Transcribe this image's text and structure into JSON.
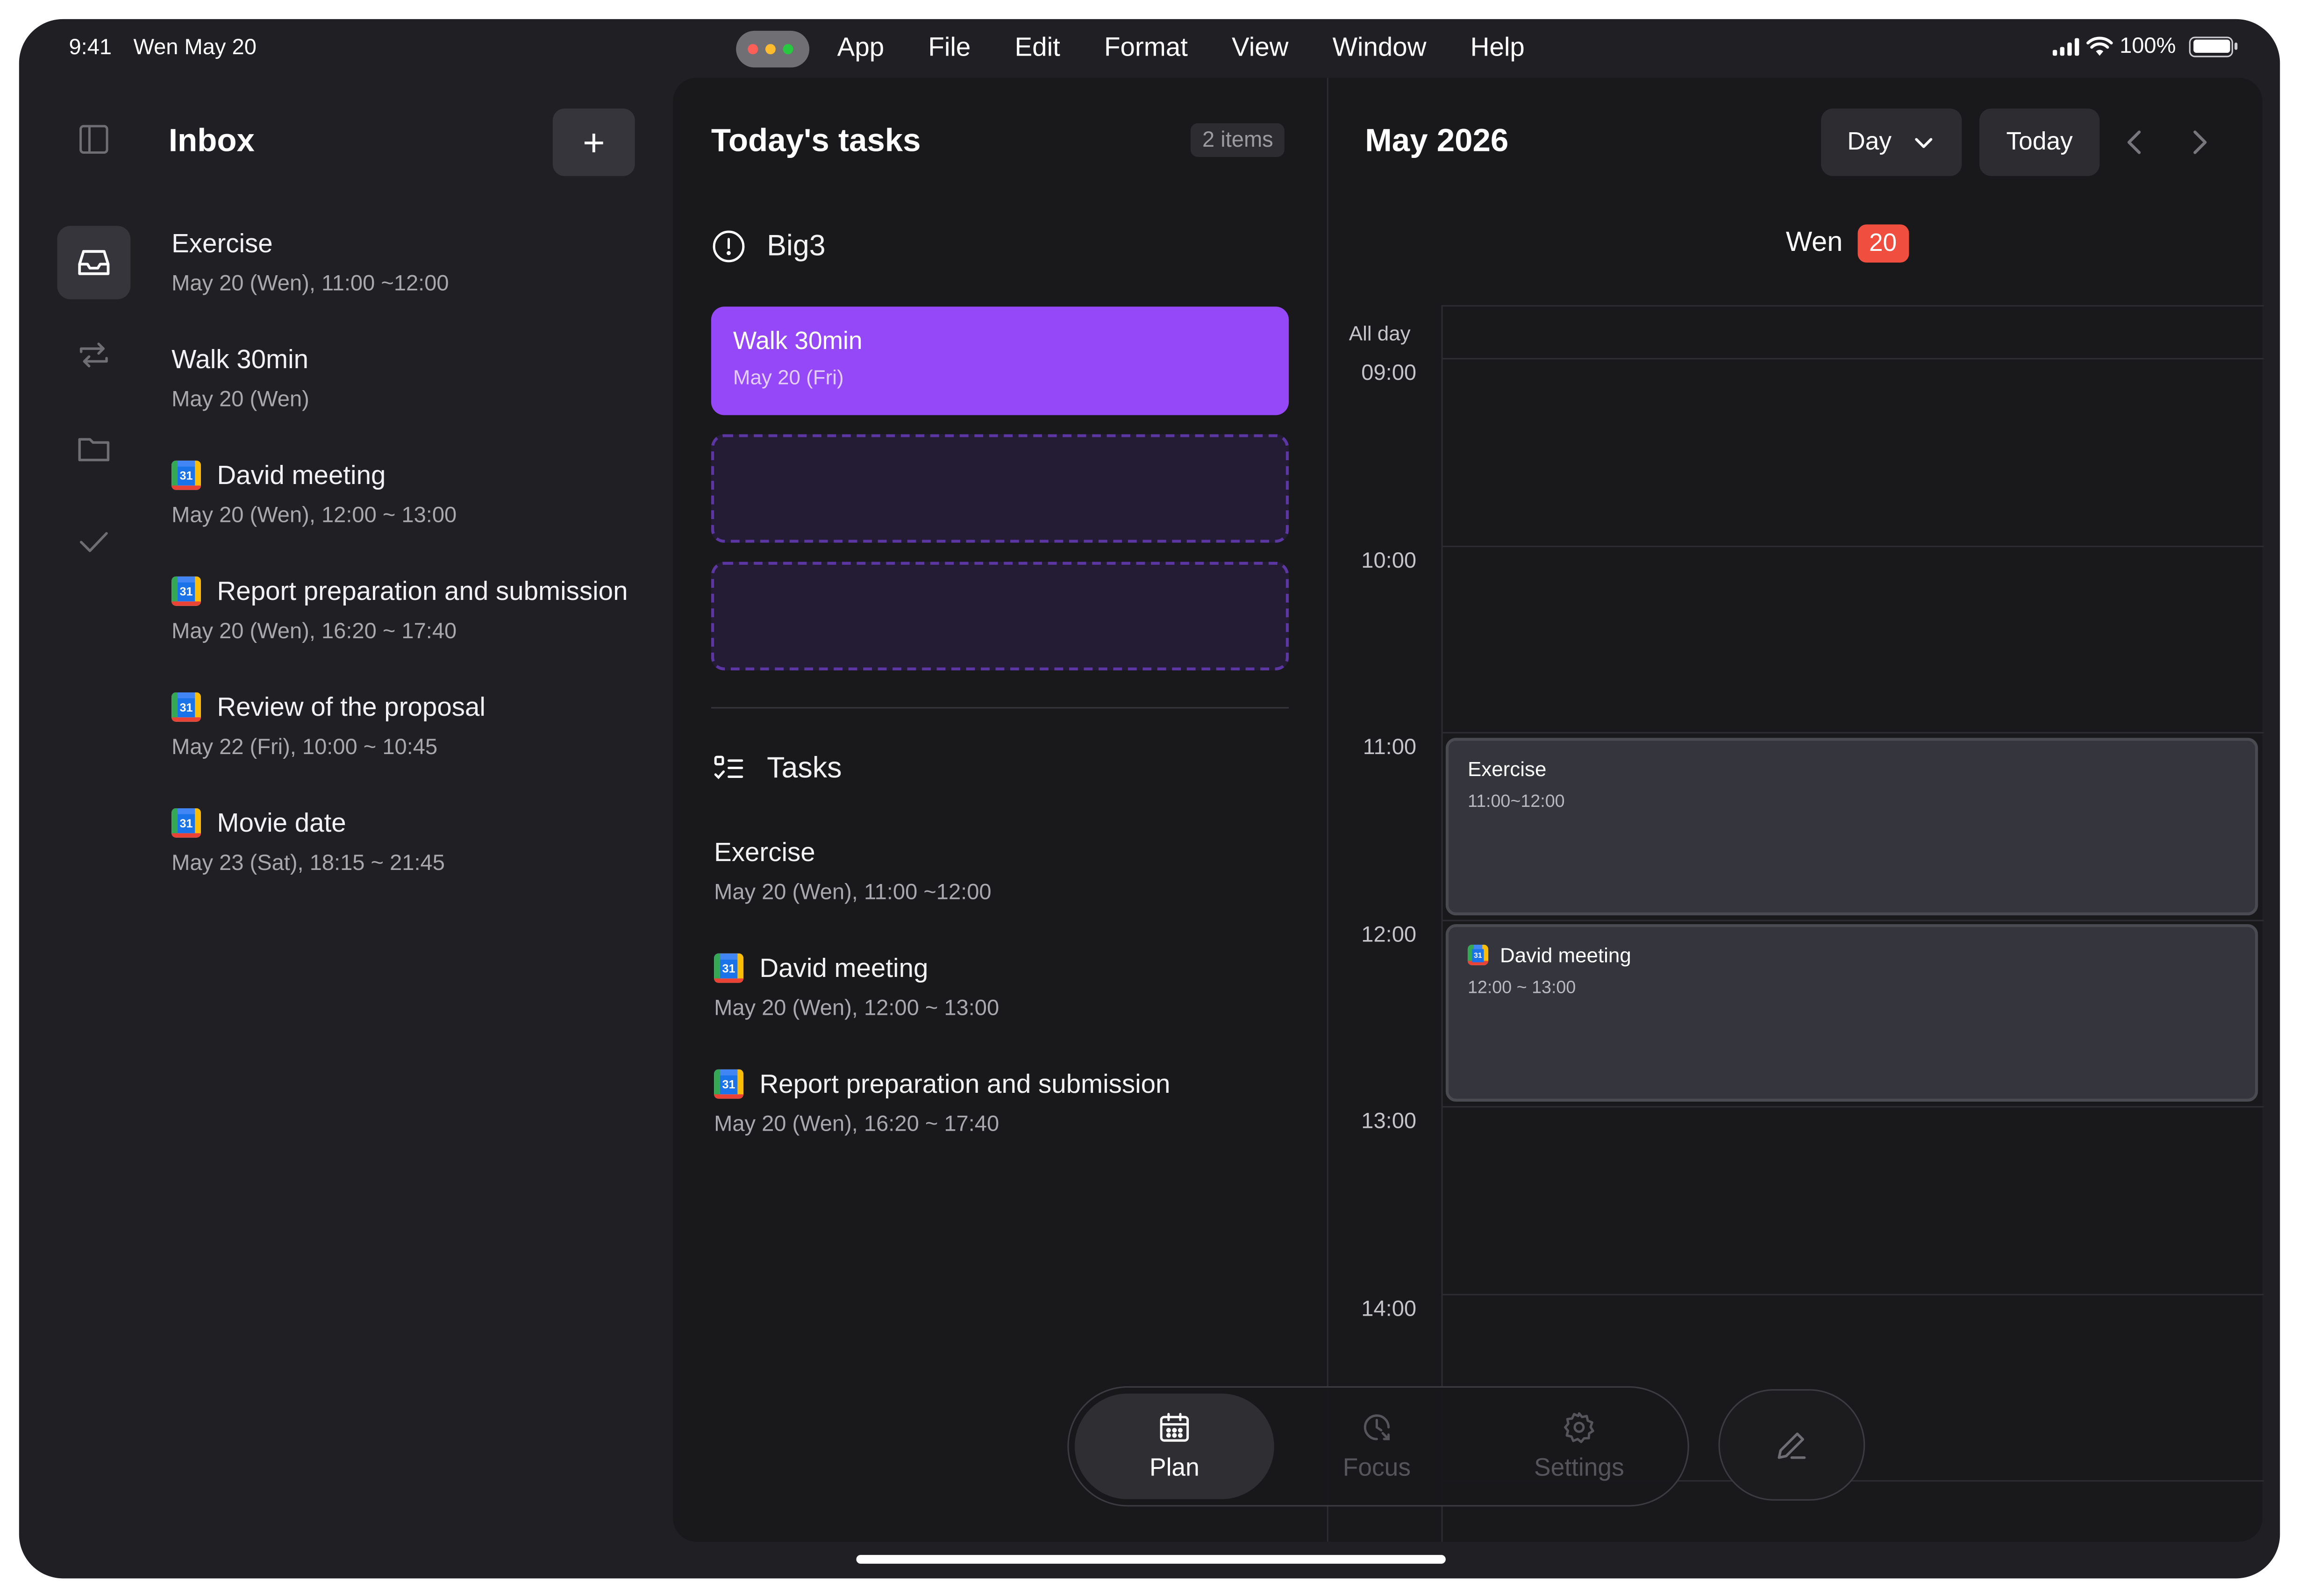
{
  "status_bar": {
    "time": "9:41",
    "date": "Wen May 20",
    "battery": "100%",
    "menu": [
      "App",
      "File",
      "Edit",
      "Format",
      "View",
      "Window",
      "Help"
    ]
  },
  "sidebar": {
    "icons": [
      "sidebar-toggle-icon",
      "inbox-icon",
      "repeat-icon",
      "folder-icon",
      "check-icon"
    ]
  },
  "inbox": {
    "title": "Inbox",
    "add_label": "+",
    "items": [
      {
        "title": "Exercise",
        "subtitle": "May 20 (Wen), 11:00 ~12:00",
        "gcal": false
      },
      {
        "title": "Walk 30min",
        "subtitle": "May 20 (Wen)",
        "gcal": false
      },
      {
        "title": "David meeting",
        "subtitle": "May 20 (Wen), 12:00 ~ 13:00",
        "gcal": true
      },
      {
        "title": "Report preparation and submission",
        "subtitle": "May 20 (Wen), 16:20 ~ 17:40",
        "gcal": true
      },
      {
        "title": "Review of the proposal",
        "subtitle": "May 22 (Fri), 10:00 ~ 10:45",
        "gcal": true
      },
      {
        "title": "Movie date",
        "subtitle": "May 23 (Sat), 18:15 ~ 21:45",
        "gcal": true
      }
    ]
  },
  "today": {
    "title": "Today's tasks",
    "count_badge": "2 items",
    "big3": {
      "label": "Big3",
      "card_title": "Walk 30min",
      "card_subtitle": "May 20 (Fri)"
    },
    "tasks_label": "Tasks",
    "tasks": [
      {
        "title": "Exercise",
        "subtitle": "May 20 (Wen), 11:00 ~12:00",
        "gcal": false
      },
      {
        "title": "David meeting",
        "subtitle": "May 20 (Wen), 12:00 ~ 13:00",
        "gcal": true
      },
      {
        "title": "Report preparation and submission",
        "subtitle": "May 20 (Wen), 16:20 ~ 17:40",
        "gcal": true
      }
    ]
  },
  "calendar": {
    "title": "May 2026",
    "view_select": "Day",
    "today_label": "Today",
    "day_name": "Wen",
    "day_number": "20",
    "all_day_label": "All day",
    "hours": [
      "09:00",
      "10:00",
      "11:00",
      "12:00",
      "13:00",
      "14:00"
    ],
    "events": [
      {
        "title": "Exercise",
        "time": "11:00~12:00",
        "gcal": false
      },
      {
        "title": "David meeting",
        "time": "12:00 ~ 13:00",
        "gcal": true
      }
    ]
  },
  "tabbar": {
    "plan": "Plan",
    "focus": "Focus",
    "settings": "Settings"
  },
  "gcal_number": "31",
  "colors": {
    "accent_purple": "#9448f7",
    "today_badge": "#f04e3e",
    "background": "#202024",
    "panel": "#19191c"
  }
}
